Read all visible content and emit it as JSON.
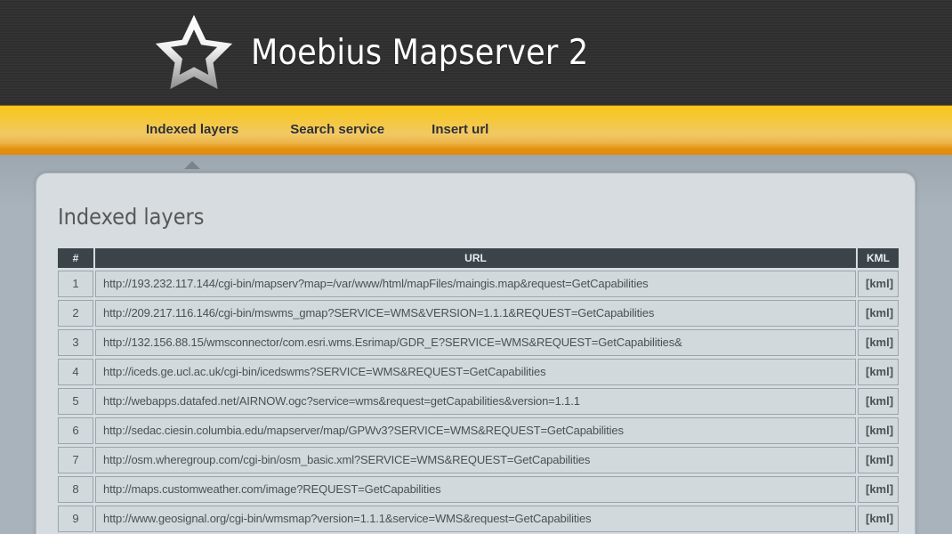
{
  "header": {
    "title": "Moebius Mapserver 2",
    "logo_icon": "star-outline-icon"
  },
  "nav": {
    "items": [
      {
        "label": "Indexed layers",
        "active": true
      },
      {
        "label": "Search service",
        "active": false
      },
      {
        "label": "Insert url",
        "active": false
      }
    ]
  },
  "main": {
    "page_title": "Indexed layers",
    "table": {
      "columns": [
        "#",
        "URL",
        "KML"
      ],
      "kml_label": "[kml]",
      "rows": [
        {
          "num": "1",
          "url": "http://193.232.117.144/cgi-bin/mapserv?map=/var/www/html/mapFiles/maingis.map&request=GetCapabilities",
          "kml": "[kml]"
        },
        {
          "num": "2",
          "url": "http://209.217.116.146/cgi-bin/mswms_gmap?SERVICE=WMS&VERSION=1.1.1&REQUEST=GetCapabilities",
          "kml": "[kml]"
        },
        {
          "num": "3",
          "url": "http://132.156.88.15/wmsconnector/com.esri.wms.Esrimap/GDR_E?SERVICE=WMS&REQUEST=GetCapabilities&",
          "kml": "[kml]"
        },
        {
          "num": "4",
          "url": "http://iceds.ge.ucl.ac.uk/cgi-bin/icedswms?SERVICE=WMS&REQUEST=GetCapabilities",
          "kml": "[kml]"
        },
        {
          "num": "5",
          "url": "http://webapps.datafed.net/AIRNOW.ogc?service=wms&request=getCapabilities&version=1.1.1",
          "kml": "[kml]"
        },
        {
          "num": "6",
          "url": "http://sedac.ciesin.columbia.edu/mapserver/map/GPWv3?SERVICE=WMS&REQUEST=GetCapabilities",
          "kml": "[kml]"
        },
        {
          "num": "7",
          "url": "http://osm.wheregroup.com/cgi-bin/osm_basic.xml?SERVICE=WMS&REQUEST=GetCapabilities",
          "kml": "[kml]"
        },
        {
          "num": "8",
          "url": "http://maps.customweather.com/image?REQUEST=GetCapabilities",
          "kml": "[kml]"
        },
        {
          "num": "9",
          "url": "http://www.geosignal.org/cgi-bin/wmsmap?version=1.1.1&service=WMS&request=GetCapabilities",
          "kml": "[kml]"
        }
      ]
    }
  },
  "colors": {
    "banner_dark": "#333333",
    "nav_gold": "#f8c91b",
    "nav_orange": "#e08b0c",
    "panel_bg": "#d6dce0",
    "table_header": "#3a4449",
    "page_bg": "#a9b3bb"
  }
}
